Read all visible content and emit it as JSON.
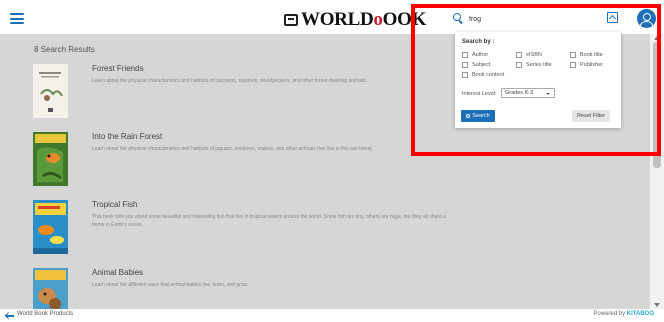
{
  "header": {
    "logo_text_a": "WORLD",
    "logo_text_o": "B",
    "logo_text_b": "OOK",
    "search_value": "frog",
    "icons": {
      "menu": "hamburger-icon",
      "search": "search-icon",
      "collapse": "chevron-up-icon",
      "user": "user-avatar-icon"
    },
    "accent_color": "#1e6fb8"
  },
  "results": {
    "count_label": "8 Search Results",
    "items": [
      {
        "title": "Forest Friends",
        "description": "Learn about the physical characteristics and habitats of raccoons, squirrels, woodpeckers, and other forest-dwelling animals."
      },
      {
        "title": "Into the Rain Forest",
        "description": "Learn about the physical characteristics and habitats of jaguars, monkeys, snakes, and other animals that live in the rain forest."
      },
      {
        "title": "Tropical Fish",
        "description": "This book tells you about some beautiful and interesting fish that live in tropical waters around the world. Some fish are tiny, others are huge, but they all share a home in Earth's ocean."
      },
      {
        "title": "Animal Babies",
        "description": "Learn about the different ways that animal babies live, learn, and grow."
      }
    ]
  },
  "filter": {
    "heading": "Search by :",
    "options": {
      "author": "Author",
      "eisbn": "eISBN",
      "book_title": "Book title",
      "subject": "Subject",
      "series_title": "Series title",
      "publisher": "Publisher",
      "book_content": "Book content"
    },
    "interest_level_label": "Interest Level:",
    "interest_level_value": "Grades K-3",
    "search_button": "Search",
    "reset_button": "Reset Filter"
  },
  "footer": {
    "back_label": "World Book Products",
    "powered_prefix": "Powered by",
    "powered_brand": "KITABOO"
  }
}
